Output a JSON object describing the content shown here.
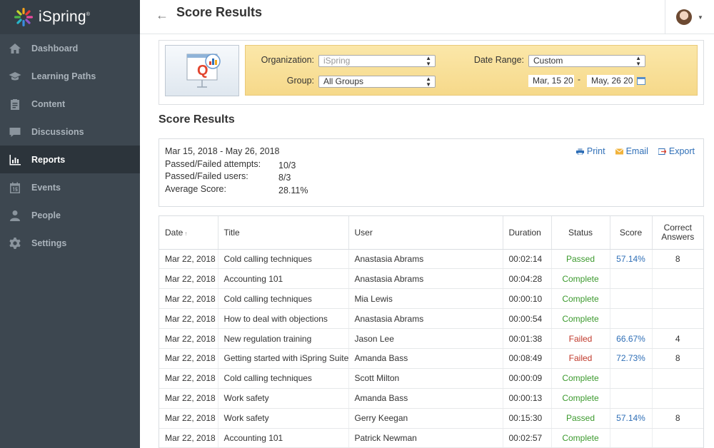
{
  "brand": {
    "name": "iSpring",
    "trademark": "®"
  },
  "nav": [
    {
      "label": "Dashboard",
      "icon": "home-icon",
      "active": false
    },
    {
      "label": "Learning Paths",
      "icon": "graduation-cap-icon",
      "active": false
    },
    {
      "label": "Content",
      "icon": "clipboard-icon",
      "active": false
    },
    {
      "label": "Discussions",
      "icon": "chat-icon",
      "active": false
    },
    {
      "label": "Reports",
      "icon": "bar-chart-icon",
      "active": true
    },
    {
      "label": "Events",
      "icon": "calendar-icon",
      "active": false
    },
    {
      "label": "People",
      "icon": "person-icon",
      "active": false
    },
    {
      "label": "Settings",
      "icon": "gear-icon",
      "active": false
    }
  ],
  "header": {
    "title": "Score Results",
    "back_icon": "back-arrow-icon"
  },
  "filters": {
    "organization_label": "Organization:",
    "organization_value": "iSpring",
    "group_label": "Group:",
    "group_value": "All Groups",
    "date_range_label": "Date Range:",
    "date_range_value": "Custom",
    "date_from": "Mar, 15 20",
    "date_to": "May, 26 20",
    "dash": "-"
  },
  "section_title": "Score Results",
  "summary": {
    "dates": "Mar 15, 2018 - May 26, 2018",
    "rows": [
      {
        "label": "Passed/Failed attempts:",
        "value": "10/3"
      },
      {
        "label": "Passed/Failed users:",
        "value": "8/3"
      },
      {
        "label": "Average Score:",
        "value": "28.11%"
      }
    ],
    "actions": {
      "print": "Print",
      "email": "Email",
      "export": "Export"
    }
  },
  "table": {
    "columns": [
      "Date",
      "Title",
      "User",
      "Duration",
      "Status",
      "Score",
      "Correct Answers"
    ],
    "rows": [
      {
        "date": "Mar 22, 2018",
        "title": "Cold calling techniques",
        "user": "Anastasia Abrams",
        "duration": "00:02:14",
        "status": "Passed",
        "score": "57.14%",
        "correct": "8"
      },
      {
        "date": "Mar 22, 2018",
        "title": "Accounting 101",
        "user": "Anastasia Abrams",
        "duration": "00:04:28",
        "status": "Complete",
        "score": "",
        "correct": ""
      },
      {
        "date": "Mar 22, 2018",
        "title": "Cold calling techniques",
        "user": "Mia Lewis",
        "duration": "00:00:10",
        "status": "Complete",
        "score": "",
        "correct": ""
      },
      {
        "date": "Mar 22, 2018",
        "title": "How to deal with objections",
        "user": "Anastasia Abrams",
        "duration": "00:00:54",
        "status": "Complete",
        "score": "",
        "correct": ""
      },
      {
        "date": "Mar 22, 2018",
        "title": "New regulation training",
        "user": "Jason Lee",
        "duration": "00:01:38",
        "status": "Failed",
        "score": "66.67%",
        "correct": "4"
      },
      {
        "date": "Mar 22, 2018",
        "title": "Getting started with iSpring Suite",
        "user": "Amanda Bass",
        "duration": "00:08:49",
        "status": "Failed",
        "score": "72.73%",
        "correct": "8"
      },
      {
        "date": "Mar 22, 2018",
        "title": "Cold calling techniques",
        "user": "Scott Milton",
        "duration": "00:00:09",
        "status": "Complete",
        "score": "",
        "correct": ""
      },
      {
        "date": "Mar 22, 2018",
        "title": "Work safety",
        "user": "Amanda Bass",
        "duration": "00:00:13",
        "status": "Complete",
        "score": "",
        "correct": ""
      },
      {
        "date": "Mar 22, 2018",
        "title": "Work safety",
        "user": "Gerry Keegan",
        "duration": "00:15:30",
        "status": "Passed",
        "score": "57.14%",
        "correct": "8"
      },
      {
        "date": "Mar 22, 2018",
        "title": "Accounting 101",
        "user": "Patrick Newman",
        "duration": "00:02:57",
        "status": "Complete",
        "score": "",
        "correct": ""
      }
    ]
  },
  "colors": {
    "sidebar": "#3d4750",
    "accent": "#2f6fb7",
    "passed": "#3c9a2e",
    "failed": "#c0392b",
    "filter_panel": "#f8dd92"
  }
}
